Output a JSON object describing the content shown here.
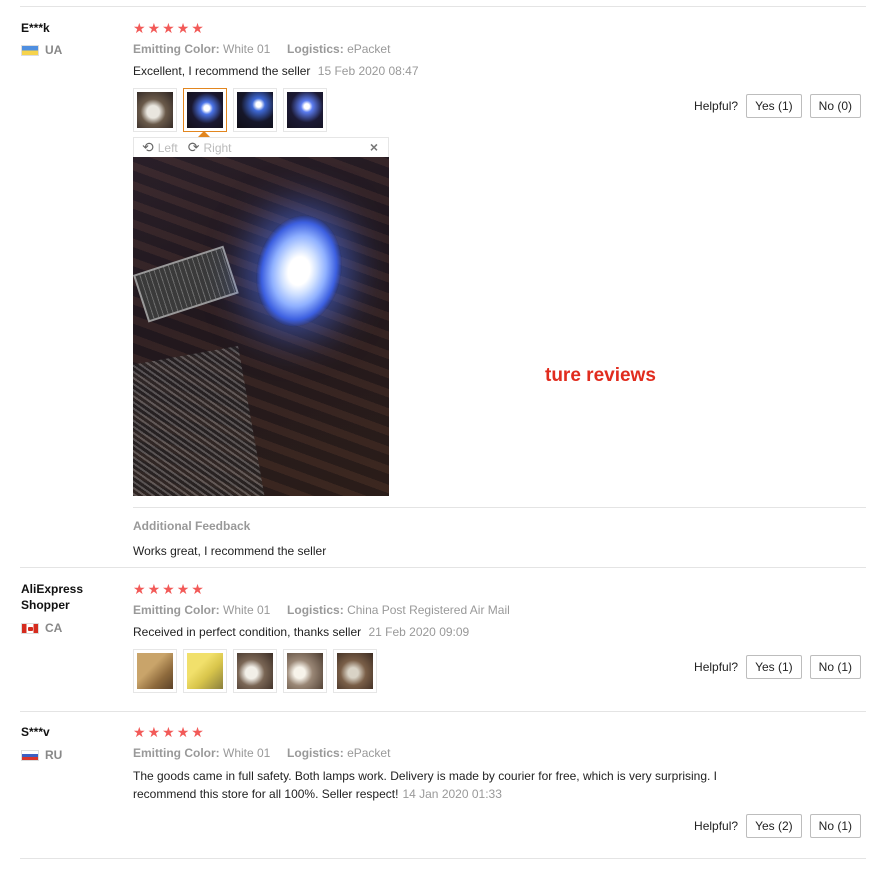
{
  "overlay_text": "ture reviews",
  "colors": {
    "star": "#f25a58",
    "overlay": "#e12c1e",
    "active_thumb": "#e2861f"
  },
  "reviews": [
    {
      "user": "E***k",
      "country": "UA",
      "flag_icon": "ukraine-flag-icon",
      "stars": 5,
      "color_label": "Emitting Color:",
      "color_value": "White 01",
      "logistics_label": "Logistics:",
      "logistics_value": "ePacket",
      "text": "Excellent, I recommend the seller",
      "date": "15 Feb 2020 08:47",
      "thumb_count": 4,
      "helpful_label": "Helpful?",
      "yes": "Yes (1)",
      "no": "No (0)",
      "viewer": {
        "left": "Left",
        "right": "Right",
        "close": "×"
      },
      "additional_feedback_label": "Additional Feedback",
      "additional_feedback_text": "Works great, I recommend the seller"
    },
    {
      "user": "AliExpress Shopper",
      "country": "CA",
      "flag_icon": "canada-flag-icon",
      "stars": 5,
      "color_label": "Emitting Color:",
      "color_value": "White 01",
      "logistics_label": "Logistics:",
      "logistics_value": "China Post Registered Air Mail",
      "text": "Received in perfect condition, thanks seller",
      "date": "21 Feb 2020 09:09",
      "thumb_count": 5,
      "helpful_label": "Helpful?",
      "yes": "Yes (1)",
      "no": "No (1)"
    },
    {
      "user": "S***v",
      "country": "RU",
      "flag_icon": "russia-flag-icon",
      "stars": 5,
      "color_label": "Emitting Color:",
      "color_value": "White 01",
      "logistics_label": "Logistics:",
      "logistics_value": "ePacket",
      "text_line1": "The goods came in full safety. Both lamps work. Delivery is made by courier for free, which is very surprising. I",
      "text_line2": "recommend this store for all 100%. Seller respect!",
      "date": "14 Jan 2020 01:33",
      "helpful_label": "Helpful?",
      "yes": "Yes (2)",
      "no": "No (1)"
    }
  ]
}
